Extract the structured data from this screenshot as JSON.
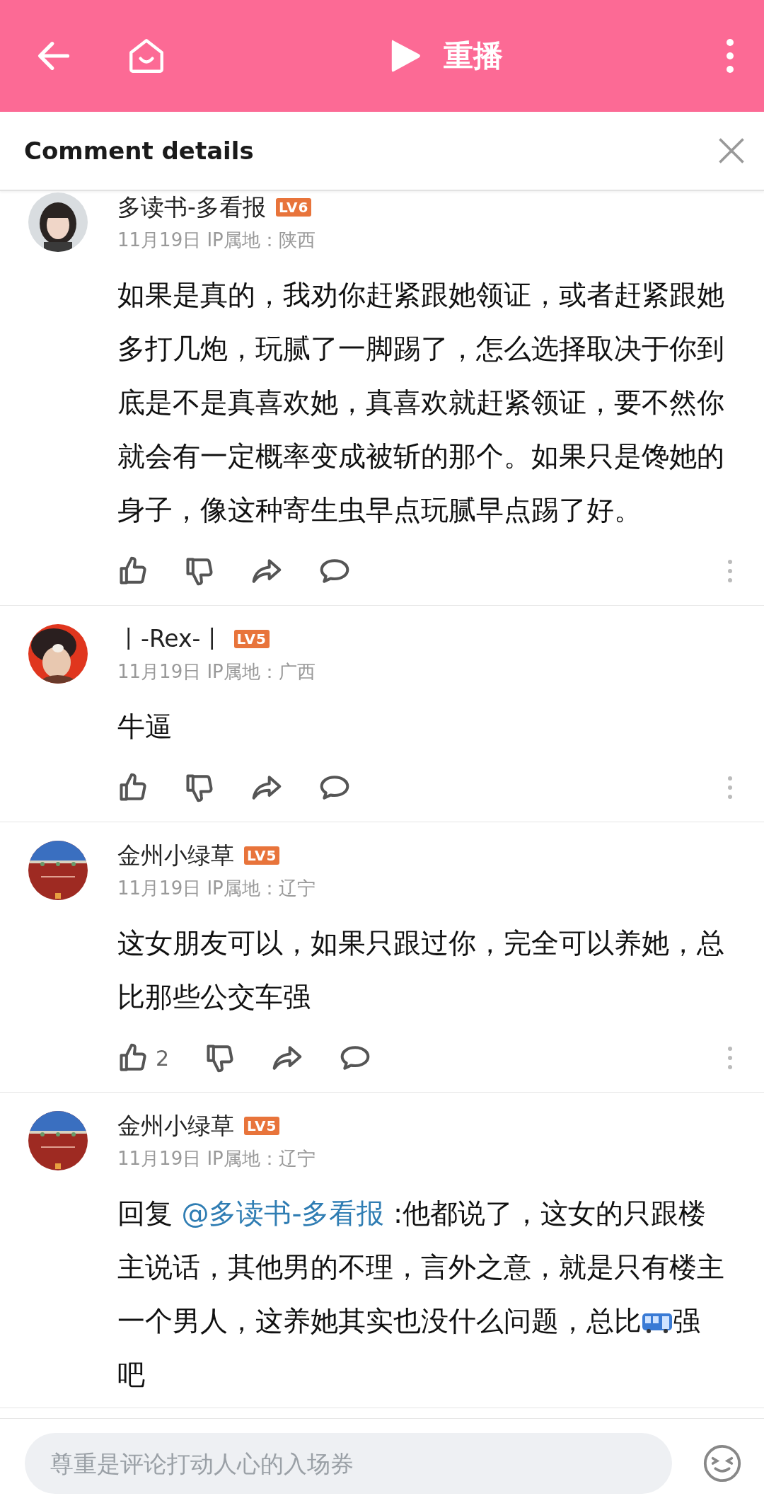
{
  "top_bar": {
    "replay_label": "重播"
  },
  "panel": {
    "title": "Comment details"
  },
  "comments": [
    {
      "user": "多读书-多看报",
      "level": "LV6",
      "date": "11月19日 IP属地：陕西",
      "body": [
        {
          "kind": "text",
          "text": "如果是真的，我劝你赶紧跟她领证，或者赶紧跟她多打几炮，玩腻了一脚踢了，怎么选择取决于你到底是不是真喜欢她，真喜欢就赶紧领证，要不然你就会有一定概率变成被斩的那个。如果只是馋她的身子，像这种寄生虫早点玩腻早点踢了好。"
        }
      ],
      "actions": true
    },
    {
      "user": "丨-Rex-丨",
      "level": "LV5",
      "date": "11月19日 IP属地：广西",
      "body": [
        {
          "kind": "text",
          "text": "牛逼"
        }
      ],
      "actions": true
    },
    {
      "user": "金州小绿草",
      "level": "LV5",
      "date": "11月19日 IP属地：辽宁",
      "body": [
        {
          "kind": "text",
          "text": "这女朋友可以，如果只跟过你，完全可以养她，总比那些公交车强"
        }
      ],
      "actions": true,
      "likes": "2"
    },
    {
      "user": "金州小绿草",
      "level": "LV5",
      "date": "11月19日 IP属地：辽宁",
      "body": [
        {
          "kind": "text",
          "text": "回复 "
        },
        {
          "kind": "mention",
          "text": "@多读书-多看报"
        },
        {
          "kind": "text",
          "text": " :他都说了，这女的只跟楼主说话，其他男的不理，言外之意，就是只有楼主一个男人，这养她其实也没什么问题，总比"
        },
        {
          "kind": "bus"
        },
        {
          "kind": "text",
          "text": "强吧"
        }
      ],
      "actions": false
    }
  ],
  "composer": {
    "placeholder": "尊重是评论打动人心的入场券"
  }
}
